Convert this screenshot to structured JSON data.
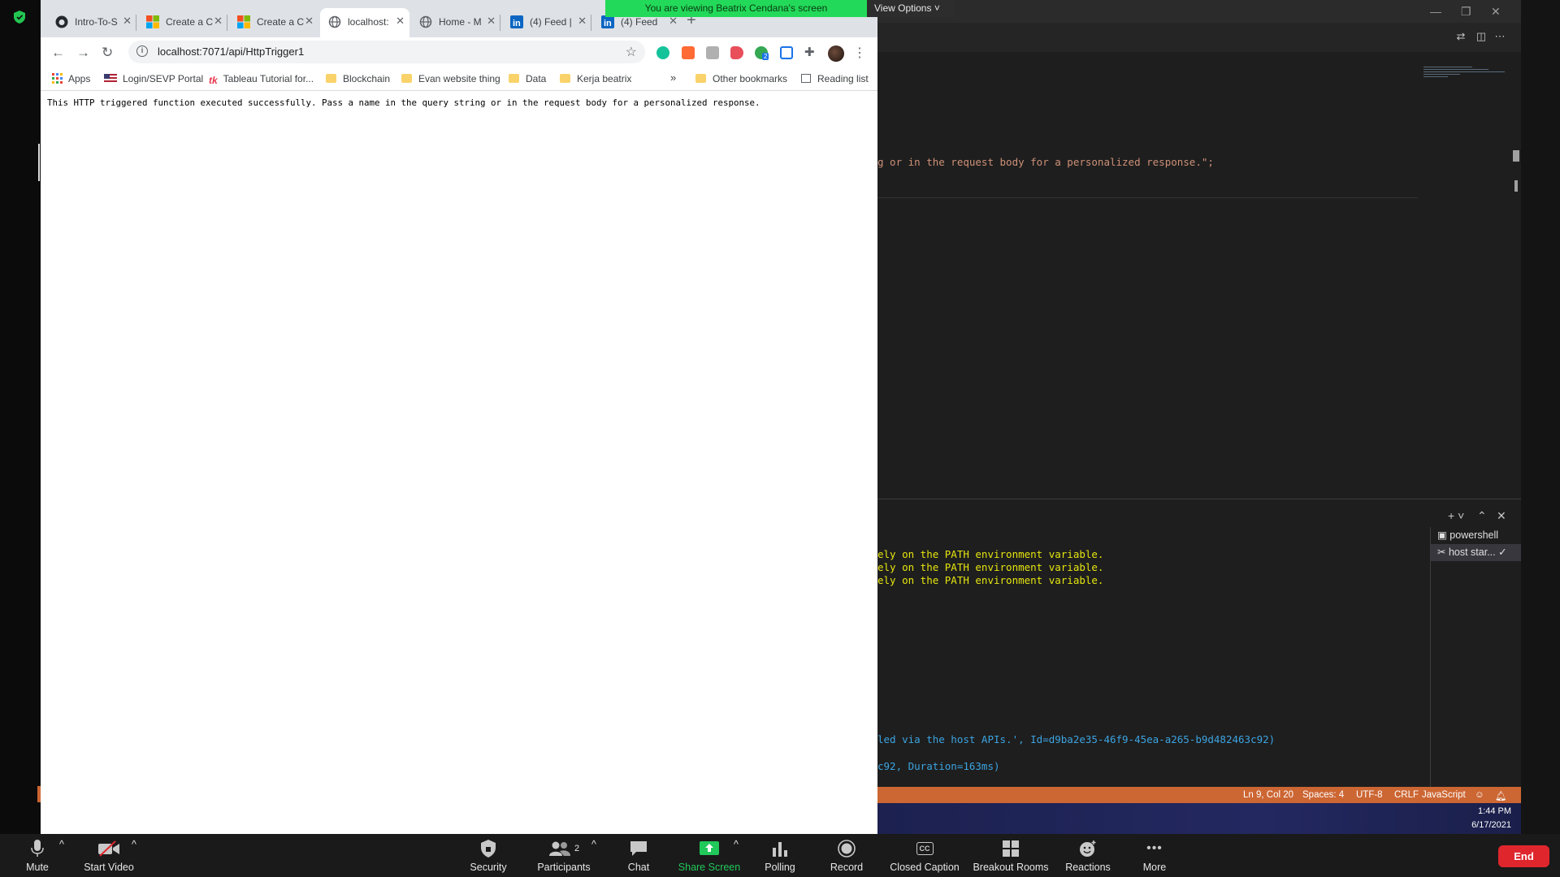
{
  "zoom": {
    "banner_text": "You are viewing Beatrix Cendana's screen",
    "view_options_label": "View Options",
    "toolbar": [
      {
        "label": "Mute",
        "icon": "microphone-icon"
      },
      {
        "label": "Start Video",
        "icon": "video-off-icon"
      },
      {
        "label": "Security",
        "icon": "shield-icon"
      },
      {
        "label": "Participants",
        "icon": "participants-icon",
        "count": "2"
      },
      {
        "label": "Chat",
        "icon": "chat-icon"
      },
      {
        "label": "Share Screen",
        "icon": "share-screen-icon"
      },
      {
        "label": "Polling",
        "icon": "polling-icon"
      },
      {
        "label": "Record",
        "icon": "record-icon"
      },
      {
        "label": "Closed Caption",
        "icon": "cc-icon",
        "icon_text": "CC"
      },
      {
        "label": "Breakout Rooms",
        "icon": "breakout-rooms-icon"
      },
      {
        "label": "Reactions",
        "icon": "reactions-icon"
      },
      {
        "label": "More",
        "icon": "more-icon",
        "icon_text": "•••"
      }
    ],
    "end_label": "End",
    "accent_green": "#23d959",
    "end_red": "#e0262d"
  },
  "browser": {
    "tabs": [
      {
        "title": "Intro-To-S",
        "icon": "github-icon"
      },
      {
        "title": "Create a C",
        "icon": "microsoft-icon"
      },
      {
        "title": "Create a C",
        "icon": "microsoft-icon"
      },
      {
        "title": "localhost:",
        "icon": "globe-icon",
        "active": true
      },
      {
        "title": "Home - M",
        "icon": "globe-icon"
      },
      {
        "title": "(4) Feed |",
        "icon": "linkedin-icon"
      },
      {
        "title": "(4) Feed",
        "icon": "linkedin-icon"
      }
    ],
    "url": "localhost:7071/api/HttpTrigger1",
    "extension_badge": "2",
    "bookmarks": [
      {
        "label": "Apps",
        "icon": "apps-grid-icon"
      },
      {
        "label": "Login/SEVP Portal",
        "icon": "us-flag-icon"
      },
      {
        "label": "Tableau Tutorial for...",
        "icon": "tableau-icon"
      },
      {
        "label": "Blockchain",
        "icon": "folder-icon"
      },
      {
        "label": "Evan website thing",
        "icon": "folder-icon"
      },
      {
        "label": "Data",
        "icon": "folder-icon"
      },
      {
        "label": "Kerja beatrix",
        "icon": "folder-icon"
      }
    ],
    "more_bookmarks": "»",
    "other_bookmarks": "Other bookmarks",
    "reading_list": "Reading list",
    "page_text": "This HTTP triggered function executed successfully. Pass a name in the query string or in the request body for a personalized response."
  },
  "vscode": {
    "code_line": "g or in the request body for a personalized response.\";",
    "terminal_lines": [
      "ely on the PATH environment variable.",
      "ely on the PATH environment variable.",
      "ely on the PATH environment variable."
    ],
    "log_line_1": "led via the host APIs.', Id=d9ba2e35-46f9-45ea-a265-b9d482463c92)",
    "log_line_2": "c92, Duration=163ms)",
    "terminals": [
      "powershell",
      "host star..."
    ],
    "status": {
      "position": "Ln 9, Col 20",
      "spaces": "Spaces: 4",
      "encoding": "UTF-8",
      "eol": "CRLF",
      "language": "JavaScript"
    },
    "status_color": "#cc6633",
    "clock_time": "1:44 PM",
    "clock_date": "6/17/2021"
  }
}
